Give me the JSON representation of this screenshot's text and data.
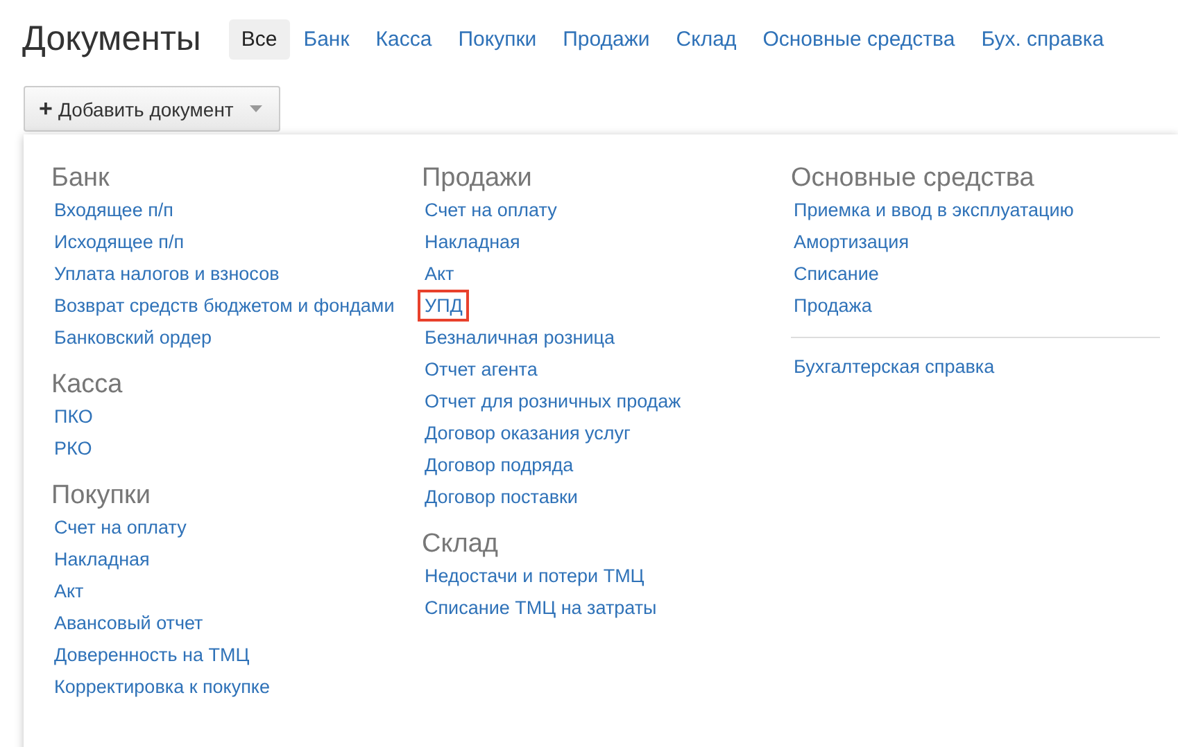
{
  "page": {
    "title": "Документы"
  },
  "tabs": [
    {
      "label": "Все",
      "selected": true
    },
    {
      "label": "Банк",
      "selected": false
    },
    {
      "label": "Касса",
      "selected": false
    },
    {
      "label": "Покупки",
      "selected": false
    },
    {
      "label": "Продажи",
      "selected": false
    },
    {
      "label": "Склад",
      "selected": false
    },
    {
      "label": "Основные средства",
      "selected": false
    },
    {
      "label": "Бух. справка",
      "selected": false
    }
  ],
  "add_button": {
    "icon": "+",
    "label": "Добавить документ"
  },
  "menu": {
    "columns": [
      {
        "sections": [
          {
            "kind": "titled",
            "heading": "Банк",
            "items": [
              {
                "label": "Входящее п/п",
                "highlighted": false
              },
              {
                "label": "Исходящее п/п",
                "highlighted": false
              },
              {
                "label": "Уплата налогов и взносов",
                "highlighted": false
              },
              {
                "label": "Возврат средств бюджетом и фондами",
                "highlighted": false
              },
              {
                "label": "Банковский ордер",
                "highlighted": false
              }
            ]
          },
          {
            "kind": "titled",
            "heading": "Касса",
            "items": [
              {
                "label": "ПКО",
                "highlighted": false
              },
              {
                "label": "РКО",
                "highlighted": false
              }
            ]
          },
          {
            "kind": "titled",
            "heading": "Покупки",
            "items": [
              {
                "label": "Счет на оплату",
                "highlighted": false
              },
              {
                "label": "Накладная",
                "highlighted": false
              },
              {
                "label": "Акт",
                "highlighted": false
              },
              {
                "label": "Авансовый отчет",
                "highlighted": false
              },
              {
                "label": "Доверенность на ТМЦ",
                "highlighted": false
              },
              {
                "label": "Корректировка к покупке",
                "highlighted": false
              }
            ]
          }
        ]
      },
      {
        "sections": [
          {
            "kind": "titled",
            "heading": "Продажи",
            "items": [
              {
                "label": "Счет на оплату",
                "highlighted": false
              },
              {
                "label": "Накладная",
                "highlighted": false
              },
              {
                "label": "Акт",
                "highlighted": false
              },
              {
                "label": "УПД",
                "highlighted": true
              },
              {
                "label": "Безналичная розница",
                "highlighted": false
              },
              {
                "label": "Отчет агента",
                "highlighted": false
              },
              {
                "label": "Отчет для розничных продаж",
                "highlighted": false
              },
              {
                "label": "Договор оказания услуг",
                "highlighted": false
              },
              {
                "label": "Договор подряда",
                "highlighted": false
              },
              {
                "label": "Договор поставки",
                "highlighted": false
              }
            ]
          },
          {
            "kind": "titled",
            "heading": "Склад",
            "items": [
              {
                "label": "Недостачи и потери ТМЦ",
                "highlighted": false
              },
              {
                "label": "Списание ТМЦ на затраты",
                "highlighted": false
              }
            ]
          }
        ]
      },
      {
        "sections": [
          {
            "kind": "titled",
            "heading": "Основные средства",
            "items": [
              {
                "label": "Приемка и ввод в эксплуатацию",
                "highlighted": false
              },
              {
                "label": "Амортизация",
                "highlighted": false
              },
              {
                "label": "Списание",
                "highlighted": false
              },
              {
                "label": "Продажа",
                "highlighted": false
              }
            ]
          },
          {
            "kind": "divided",
            "items": [
              {
                "label": "Бухгалтерская справка",
                "highlighted": false
              }
            ]
          }
        ]
      }
    ]
  }
}
